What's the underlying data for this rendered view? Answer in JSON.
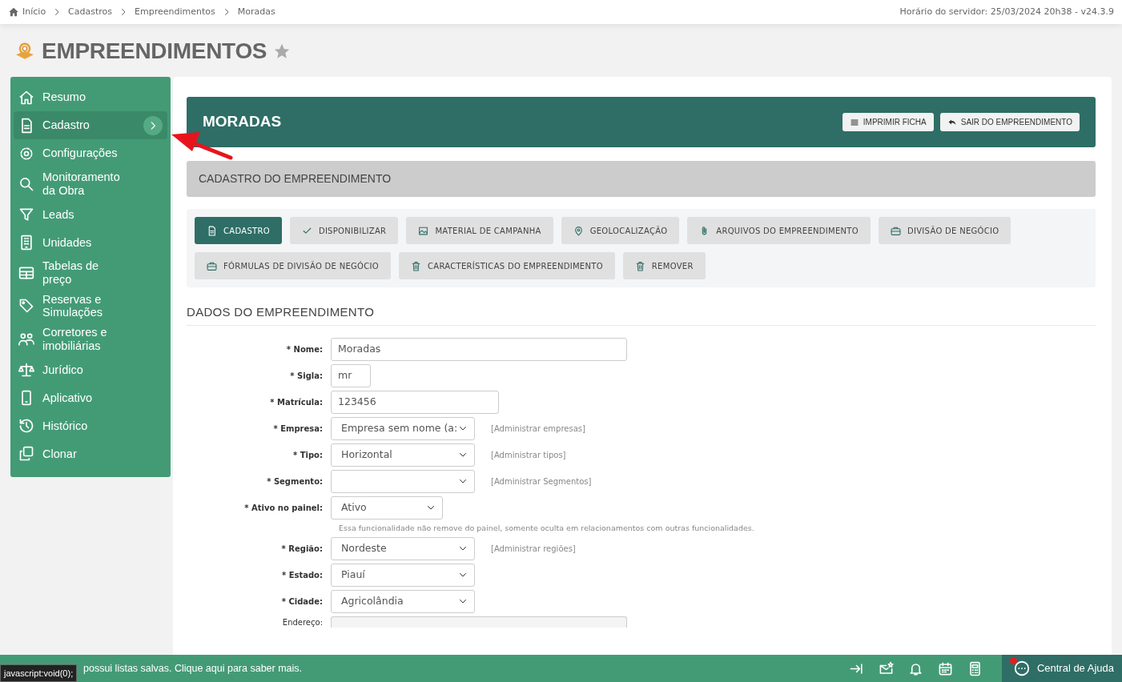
{
  "breadcrumb": [
    {
      "label": "Início",
      "kind": "home"
    },
    {
      "label": "Cadastros",
      "kind": "link"
    },
    {
      "label": "Empreendimentos",
      "kind": "link"
    },
    {
      "label": "Moradas",
      "kind": "current"
    }
  ],
  "server_info": "Horário do servidor: 25/03/2024 20h38 - v24.3.9",
  "page_title": "EMPREENDIMENTOS",
  "favorite": false,
  "sidebar": {
    "items": [
      {
        "label": "Resumo",
        "selected": false
      },
      {
        "label": "Cadastro",
        "selected": true
      },
      {
        "label": "Configurações",
        "selected": false
      },
      {
        "label": "Monitoramento da Obra",
        "selected": false
      },
      {
        "label": "Leads",
        "selected": false
      },
      {
        "label": "Unidades",
        "selected": false
      },
      {
        "label": "Tabelas de preço",
        "selected": false
      },
      {
        "label": "Reservas e Simulações",
        "selected": false
      },
      {
        "label": "Corretores e imobiliárias",
        "selected": false
      },
      {
        "label": "Jurídico",
        "selected": false
      },
      {
        "label": "Aplicativo",
        "selected": false
      },
      {
        "label": "Histórico",
        "selected": false
      },
      {
        "label": "Clonar",
        "selected": false
      }
    ]
  },
  "header": {
    "title": "MORADAS",
    "buttons": [
      "IMPRIMIR FICHA",
      "SAIR DO EMPREENDIMENTO"
    ]
  },
  "section_bar": "CADASTRO DO EMPREENDIMENTO",
  "tabs": [
    {
      "label": "CADASTRO",
      "selected": true
    },
    {
      "label": "DISPONIBILIZAR",
      "selected": false
    },
    {
      "label": "MATERIAL DE CAMPANHA",
      "selected": false
    },
    {
      "label": "GEOLOCALIZAÇÃO",
      "selected": false
    },
    {
      "label": "ARQUIVOS DO EMPREENDIMENTO",
      "selected": false
    },
    {
      "label": "DIVISÃO DE NEGÓCIO",
      "selected": false
    },
    {
      "label": "FÓRMULAS DE DIVISÃO DE NEGÓCIO",
      "selected": false
    },
    {
      "label": "CARACTERÍSTICAS DO EMPREENDIMENTO",
      "selected": false
    },
    {
      "label": "REMOVER",
      "selected": false
    }
  ],
  "form": {
    "title": "DADOS DO EMPREENDIMENTO",
    "fields": [
      {
        "label": "* Nome:",
        "required": true,
        "kind": "text",
        "value": "Moradas"
      },
      {
        "label": "* Sigla:",
        "required": true,
        "kind": "text",
        "value": "mr"
      },
      {
        "label": "* Matrícula:",
        "required": true,
        "kind": "text",
        "value": "123456"
      },
      {
        "label": "* Empresa:",
        "required": true,
        "kind": "select",
        "value": "Empresa sem nome (a:",
        "link": "[Administrar empresas]"
      },
      {
        "label": "* Tipo:",
        "required": true,
        "kind": "select",
        "value": "Horizontal",
        "link": "[Administrar tipos]"
      },
      {
        "label": "* Segmento:",
        "required": true,
        "kind": "select",
        "link": "[Administrar Segmentos]"
      },
      {
        "label": "* Ativo no painel:",
        "required": true,
        "kind": "select",
        "value": "Ativo",
        "hint": "Essa funcionalidade não remove do painel, somente oculta em relacionamentos com outras funcionalidades."
      },
      {
        "label": "* Região:",
        "required": true,
        "kind": "select",
        "value": "Nordeste",
        "link": "[Administrar regiões]"
      },
      {
        "label": "* Estado:",
        "required": true,
        "kind": "select",
        "value": "Piauí"
      },
      {
        "label": "* Cidade:",
        "required": true,
        "kind": "select",
        "value": "Agricolândia"
      },
      {
        "label": "Endereço:",
        "required": false,
        "kind": "readonly"
      }
    ]
  },
  "bottom_bar": {
    "message": "possui listas salvas. Clique aqui para saber mais.",
    "help": "Central de Ajuda",
    "notification": true,
    "tooltip": "javascript:void(0);"
  }
}
